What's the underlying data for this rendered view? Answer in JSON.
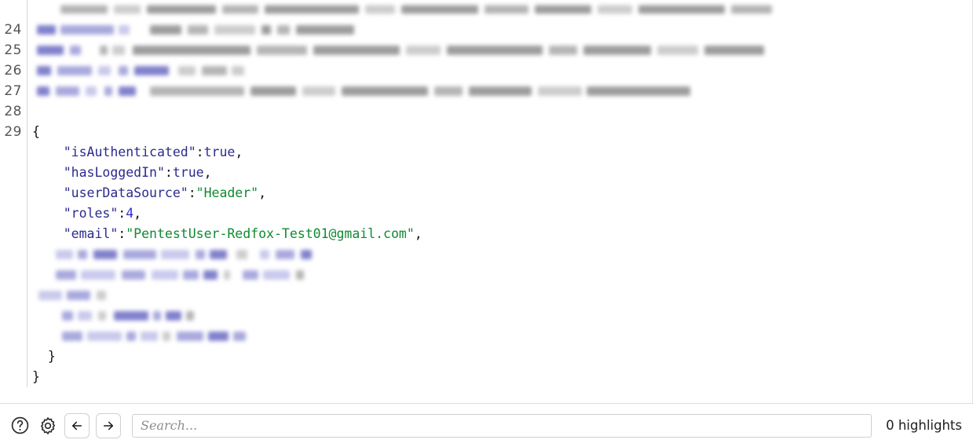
{
  "editor": {
    "gutter_visible": true,
    "lines": [
      {
        "number": "",
        "type": "redacted",
        "clipped": true,
        "blobs": [
          [
            36,
            118,
            11,
            "g"
          ],
          [
            160,
            52,
            11,
            "g2"
          ],
          [
            218,
            70,
            11,
            "g"
          ],
          [
            296,
            44,
            11,
            "g3"
          ],
          [
            348,
            96,
            11,
            "g"
          ],
          [
            452,
            60,
            11,
            "g2"
          ],
          [
            520,
            112,
            11,
            "g"
          ],
          [
            640,
            48,
            11,
            "g3"
          ],
          [
            696,
            86,
            11,
            "g"
          ],
          [
            790,
            54,
            11,
            "g2"
          ],
          [
            852,
            74,
            11,
            "g"
          ],
          [
            934,
            40,
            11,
            "g3"
          ],
          [
            982,
            96,
            11,
            "g"
          ]
        ]
      },
      {
        "number": "",
        "type": "redacted",
        "clipped": true,
        "blobs": [
          [
            36,
            60,
            11,
            "g2"
          ],
          [
            104,
            34,
            11,
            "g3"
          ],
          [
            146,
            88,
            11,
            "g"
          ],
          [
            242,
            46,
            11,
            "g2"
          ],
          [
            296,
            120,
            11,
            "g"
          ],
          [
            424,
            38,
            11,
            "g3"
          ],
          [
            470,
            98,
            11,
            "g"
          ],
          [
            576,
            56,
            11,
            "g2"
          ],
          [
            640,
            72,
            11,
            "g"
          ],
          [
            720,
            44,
            11,
            "g3"
          ],
          [
            772,
            110,
            11,
            "g"
          ],
          [
            890,
            52,
            11,
            "g2"
          ]
        ]
      },
      {
        "number": "24",
        "type": "redacted",
        "blobs": [
          [
            6,
            24,
            12,
            "b"
          ],
          [
            36,
            68,
            12,
            "b2"
          ],
          [
            110,
            14,
            12,
            "b3"
          ],
          [
            150,
            40,
            12,
            "g"
          ],
          [
            198,
            26,
            12,
            "g2"
          ],
          [
            232,
            52,
            12,
            "g3"
          ],
          [
            292,
            12,
            12,
            "g"
          ],
          [
            312,
            16,
            12,
            "g2"
          ],
          [
            336,
            74,
            12,
            "g"
          ]
        ]
      },
      {
        "number": "25",
        "type": "redacted",
        "blobs": [
          [
            6,
            34,
            12,
            "b"
          ],
          [
            48,
            14,
            12,
            "b2"
          ],
          [
            86,
            10,
            12,
            "g2"
          ],
          [
            102,
            16,
            12,
            "g3"
          ],
          [
            128,
            150,
            12,
            "g"
          ],
          [
            286,
            64,
            12,
            "g2"
          ],
          [
            358,
            110,
            12,
            "g"
          ],
          [
            476,
            44,
            12,
            "g3"
          ],
          [
            528,
            122,
            12,
            "g"
          ],
          [
            658,
            36,
            12,
            "g2"
          ],
          [
            702,
            86,
            12,
            "g"
          ],
          [
            796,
            52,
            12,
            "g3"
          ],
          [
            856,
            76,
            12,
            "g"
          ]
        ]
      },
      {
        "number": "26",
        "type": "redacted",
        "blobs": [
          [
            6,
            18,
            12,
            "b"
          ],
          [
            32,
            44,
            12,
            "b2"
          ],
          [
            84,
            16,
            12,
            "b3"
          ],
          [
            110,
            12,
            12,
            "b2"
          ],
          [
            130,
            44,
            12,
            "b"
          ],
          [
            186,
            22,
            12,
            "g3"
          ],
          [
            216,
            32,
            12,
            "g2"
          ],
          [
            254,
            16,
            12,
            "g3"
          ]
        ]
      },
      {
        "number": "27",
        "type": "redacted",
        "blobs": [
          [
            6,
            16,
            12,
            "b"
          ],
          [
            30,
            30,
            12,
            "b2"
          ],
          [
            68,
            14,
            12,
            "b3"
          ],
          [
            92,
            10,
            12,
            "b2"
          ],
          [
            110,
            22,
            12,
            "b"
          ],
          [
            150,
            120,
            12,
            "g2"
          ],
          [
            278,
            58,
            12,
            "g"
          ],
          [
            344,
            42,
            12,
            "g3"
          ],
          [
            394,
            110,
            12,
            "g"
          ],
          [
            512,
            36,
            12,
            "g2"
          ],
          [
            556,
            80,
            12,
            "g"
          ],
          [
            644,
            56,
            12,
            "g3"
          ],
          [
            706,
            132,
            12,
            "g"
          ]
        ]
      },
      {
        "number": "28",
        "type": "blank"
      },
      {
        "number": "29",
        "type": "code",
        "tokens": [
          {
            "t": "punct",
            "s": "{"
          }
        ]
      },
      {
        "number": "",
        "type": "code",
        "tokens": [
          {
            "t": "punct",
            "s": "    "
          },
          {
            "t": "key",
            "s": "\"isAuthenticated\""
          },
          {
            "t": "punct",
            "s": ":"
          },
          {
            "t": "bool",
            "s": "true"
          },
          {
            "t": "punct",
            "s": ","
          }
        ]
      },
      {
        "number": "",
        "type": "code",
        "tokens": [
          {
            "t": "punct",
            "s": "    "
          },
          {
            "t": "key",
            "s": "\"hasLoggedIn\""
          },
          {
            "t": "punct",
            "s": ":"
          },
          {
            "t": "bool",
            "s": "true"
          },
          {
            "t": "punct",
            "s": ","
          }
        ]
      },
      {
        "number": "",
        "type": "code",
        "tokens": [
          {
            "t": "punct",
            "s": "    "
          },
          {
            "t": "key",
            "s": "\"userDataSource\""
          },
          {
            "t": "punct",
            "s": ":"
          },
          {
            "t": "str",
            "s": "\"Header\""
          },
          {
            "t": "punct",
            "s": ","
          }
        ]
      },
      {
        "number": "",
        "type": "code",
        "tokens": [
          {
            "t": "punct",
            "s": "    "
          },
          {
            "t": "key",
            "s": "\"roles\""
          },
          {
            "t": "punct",
            "s": ":"
          },
          {
            "t": "num",
            "s": "4"
          },
          {
            "t": "punct",
            "s": ","
          }
        ]
      },
      {
        "number": "",
        "type": "code",
        "tokens": [
          {
            "t": "punct",
            "s": "    "
          },
          {
            "t": "key",
            "s": "\"email\""
          },
          {
            "t": "punct",
            "s": ":"
          },
          {
            "t": "str",
            "s": "\"PentestUser-Redfox-Test01@gmail.com\""
          },
          {
            "t": "punct",
            "s": ","
          }
        ]
      },
      {
        "number": "",
        "type": "redacted",
        "blobs": [
          [
            30,
            22,
            12,
            "b3"
          ],
          [
            58,
            12,
            12,
            "b2"
          ],
          [
            78,
            30,
            12,
            "b"
          ],
          [
            116,
            42,
            12,
            "b2"
          ],
          [
            164,
            36,
            12,
            "b3"
          ],
          [
            208,
            12,
            12,
            "b2"
          ],
          [
            226,
            22,
            12,
            "b"
          ],
          [
            260,
            14,
            12,
            "g3"
          ],
          [
            290,
            12,
            12,
            "b3"
          ],
          [
            310,
            24,
            12,
            "b2"
          ],
          [
            342,
            14,
            12,
            "b"
          ]
        ]
      },
      {
        "number": "",
        "type": "redacted",
        "blobs": [
          [
            30,
            26,
            12,
            "b2"
          ],
          [
            62,
            44,
            12,
            "b3"
          ],
          [
            114,
            30,
            12,
            "b2"
          ],
          [
            152,
            34,
            12,
            "b3"
          ],
          [
            192,
            20,
            12,
            "b2"
          ],
          [
            218,
            18,
            12,
            "b"
          ],
          [
            244,
            8,
            12,
            "g3"
          ],
          [
            268,
            20,
            12,
            "b2"
          ],
          [
            294,
            34,
            12,
            "b3"
          ],
          [
            336,
            10,
            12,
            "g2"
          ]
        ]
      },
      {
        "number": "",
        "type": "redacted",
        "blobs": [
          [
            8,
            30,
            12,
            "b3"
          ],
          [
            44,
            30,
            12,
            "b2"
          ],
          [
            82,
            12,
            12,
            "g3"
          ]
        ]
      },
      {
        "number": "",
        "type": "redacted",
        "blobs": [
          [
            38,
            14,
            12,
            "b2"
          ],
          [
            58,
            18,
            12,
            "b3"
          ],
          [
            84,
            10,
            12,
            "g3"
          ],
          [
            104,
            44,
            12,
            "b"
          ],
          [
            154,
            10,
            12,
            "b2"
          ],
          [
            170,
            20,
            12,
            "b"
          ],
          [
            196,
            10,
            12,
            "g2"
          ]
        ]
      },
      {
        "number": "",
        "type": "redacted",
        "blobs": [
          [
            38,
            26,
            12,
            "b2"
          ],
          [
            70,
            44,
            12,
            "b3"
          ],
          [
            120,
            12,
            12,
            "b2"
          ],
          [
            138,
            22,
            12,
            "b3"
          ],
          [
            166,
            10,
            12,
            "g3"
          ],
          [
            184,
            34,
            12,
            "b2"
          ],
          [
            224,
            26,
            12,
            "b"
          ],
          [
            256,
            16,
            12,
            "b2"
          ]
        ]
      },
      {
        "number": "",
        "type": "code",
        "tokens": [
          {
            "t": "punct",
            "s": "  }"
          }
        ]
      },
      {
        "number": "",
        "type": "code",
        "tokens": [
          {
            "t": "punct",
            "s": "}"
          }
        ]
      }
    ]
  },
  "toolbar": {
    "help_label": "Help",
    "settings_label": "Settings",
    "back_label": "Previous",
    "forward_label": "Next",
    "search": {
      "value": "",
      "placeholder": "Search..."
    },
    "highlights_text": "0 highlights"
  }
}
